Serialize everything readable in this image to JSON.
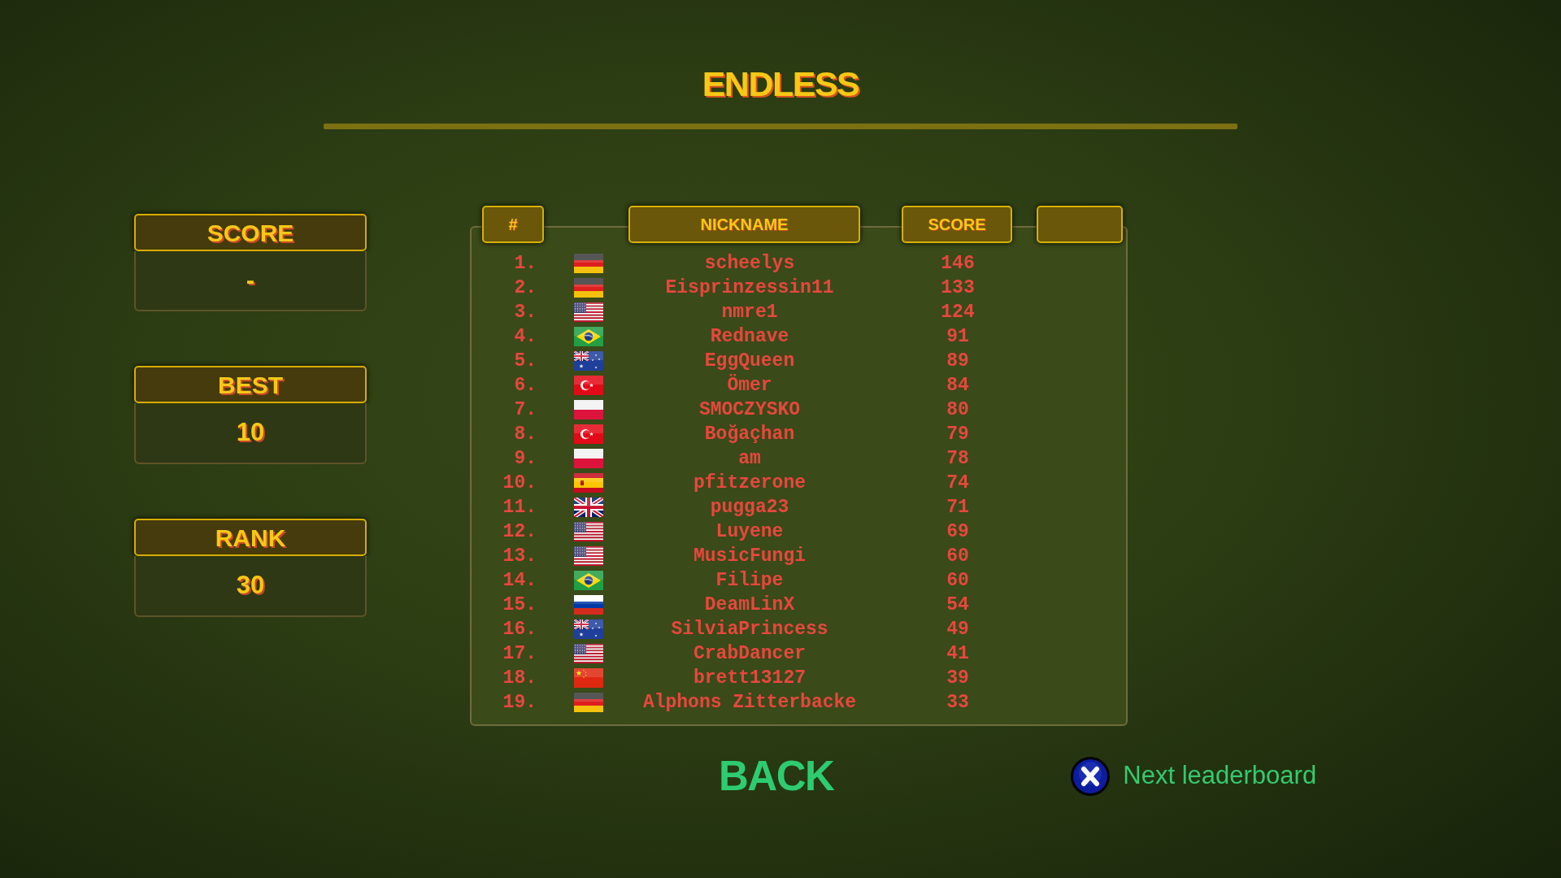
{
  "title": "ENDLESS",
  "stats": [
    {
      "label": "SCORE",
      "value": "-"
    },
    {
      "label": "BEST",
      "value": "10"
    },
    {
      "label": "RANK",
      "value": "30"
    }
  ],
  "table": {
    "columns": [
      "#",
      "NICKNAME",
      "SCORE"
    ],
    "rows": [
      {
        "rank": "1.",
        "kind": "germany",
        "nickname": "scheelys",
        "score": "146"
      },
      {
        "rank": "2.",
        "kind": "germany",
        "nickname": "Eisprinzessin11",
        "score": "133"
      },
      {
        "rank": "3.",
        "kind": "usa",
        "nickname": "nmre1",
        "score": "124"
      },
      {
        "rank": "4.",
        "kind": "brazil",
        "nickname": "Rednave",
        "score": "91"
      },
      {
        "rank": "5.",
        "kind": "australia",
        "nickname": "EggQueen",
        "score": "89"
      },
      {
        "rank": "6.",
        "kind": "turkey",
        "nickname": "Ömer",
        "score": "84"
      },
      {
        "rank": "7.",
        "kind": "poland",
        "nickname": "SMOCZYSKO",
        "score": "80"
      },
      {
        "rank": "8.",
        "kind": "turkey",
        "nickname": "Boğaçhan",
        "score": "79"
      },
      {
        "rank": "9.",
        "kind": "poland",
        "nickname": "am",
        "score": "78"
      },
      {
        "rank": "10.",
        "kind": "spain",
        "nickname": "pfitzerone",
        "score": "74"
      },
      {
        "rank": "11.",
        "kind": "uk",
        "nickname": "pugga23",
        "score": "71"
      },
      {
        "rank": "12.",
        "kind": "usa",
        "nickname": "Luyene",
        "score": "69"
      },
      {
        "rank": "13.",
        "kind": "usa",
        "nickname": "MusicFungi",
        "score": "60"
      },
      {
        "rank": "14.",
        "kind": "brazil",
        "nickname": "Filipe",
        "score": "60"
      },
      {
        "rank": "15.",
        "kind": "russia",
        "nickname": "DeamLinX",
        "score": "54"
      },
      {
        "rank": "16.",
        "kind": "australia",
        "nickname": "SilviaPrincess",
        "score": "49"
      },
      {
        "rank": "17.",
        "kind": "usa",
        "nickname": "CrabDancer",
        "score": "41"
      },
      {
        "rank": "18.",
        "kind": "china",
        "nickname": "brett13127",
        "score": "39"
      },
      {
        "rank": "19.",
        "kind": "germany",
        "nickname": "Alphons Zitterbacke",
        "score": "33"
      }
    ]
  },
  "back_button": "BACK",
  "next_leaderboard": "Next leaderboard"
}
